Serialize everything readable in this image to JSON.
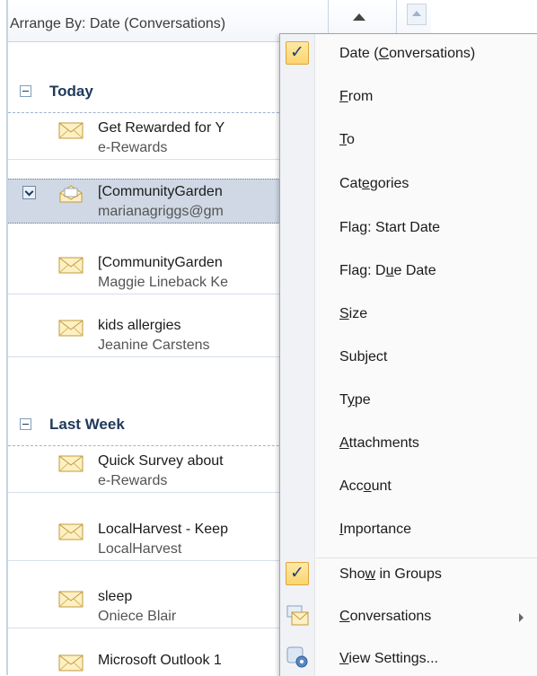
{
  "header": {
    "arrange_label": "Arrange By: Date (Conversations)"
  },
  "groups": [
    {
      "title": "Today"
    },
    {
      "title": "Last Week"
    }
  ],
  "today_items": [
    {
      "subject": "Get Rewarded for Y",
      "from": "e-Rewards"
    },
    {
      "subject": "[CommunityGarden",
      "from": "marianagriggs@gm"
    },
    {
      "subject": "[CommunityGarden",
      "from": "Maggie Lineback Ke"
    },
    {
      "subject": "kids allergies",
      "from": "Jeanine Carstens"
    }
  ],
  "lastweek_items": [
    {
      "subject": "Quick Survey about",
      "from": "e-Rewards"
    },
    {
      "subject": "LocalHarvest - Keep",
      "from": "LocalHarvest"
    },
    {
      "subject": "sleep",
      "from": "Oniece Blair"
    },
    {
      "subject": "Microsoft Outlook 1",
      "from": ""
    }
  ],
  "menu": {
    "items": [
      {
        "pre": "Date (",
        "key": "C",
        "post": "onversations)",
        "checked": true
      },
      {
        "pre": "",
        "key": "F",
        "post": "rom"
      },
      {
        "pre": "",
        "key": "T",
        "post": "o"
      },
      {
        "pre": "Cat",
        "key": "e",
        "post": "gories"
      },
      {
        "pre": "Fla",
        "key": "g",
        "post": ": Start Date"
      },
      {
        "pre": "Flag: D",
        "key": "u",
        "post": "e Date"
      },
      {
        "pre": "",
        "key": "S",
        "post": "ize"
      },
      {
        "pre": "Sub",
        "key": "j",
        "post": "ect"
      },
      {
        "pre": "T",
        "key": "y",
        "post": "pe"
      },
      {
        "pre": "",
        "key": "A",
        "post": "ttachments"
      },
      {
        "pre": "Acc",
        "key": "o",
        "post": "unt"
      },
      {
        "pre": "",
        "key": "I",
        "post": "mportance"
      }
    ],
    "show_in_groups": {
      "pre": "Sho",
      "key": "w",
      "post": " in Groups",
      "checked": true
    },
    "conversations": {
      "pre": "",
      "key": "C",
      "post": "onversations"
    },
    "view_settings": {
      "pre": "",
      "key": "V",
      "post": "iew Settings..."
    },
    "check_glyph": "✓"
  },
  "colors": {
    "accent": "#1e395b",
    "selection": "#cfd8e4",
    "check_bg": "#fbd56e"
  },
  "icons": [
    "envelope-icon",
    "open-envelope-icon",
    "collapse-icon",
    "conversations-icon",
    "view-settings-icon"
  ]
}
